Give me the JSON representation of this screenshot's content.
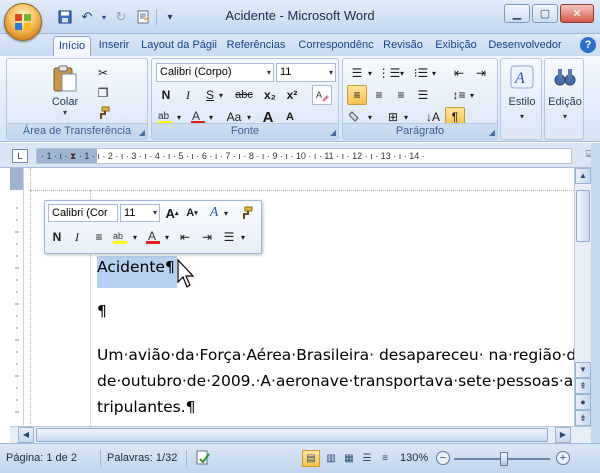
{
  "window": {
    "title": "Acidente - Microsoft Word",
    "controls": [
      "minimize",
      "maximize",
      "close"
    ]
  },
  "qat": {
    "icons": [
      "save-icon",
      "undo-icon",
      "redo-icon",
      "new-document-icon",
      "customize-icon"
    ],
    "more": "▾"
  },
  "tabs": [
    {
      "label": "Início",
      "active": true
    },
    {
      "label": "Inserir"
    },
    {
      "label": "Layout da Págii"
    },
    {
      "label": "Referências"
    },
    {
      "label": "Correspondênc"
    },
    {
      "label": "Revisão"
    },
    {
      "label": "Exibição"
    },
    {
      "label": "Desenvolvedor"
    }
  ],
  "ribbon": {
    "clipboard": {
      "group_label": "Área de Transferência",
      "paste_label": "Colar"
    },
    "font": {
      "group_label": "Fonte",
      "font_name": "Calibri (Corpo)",
      "font_size": "11",
      "bold": "N",
      "italic": "I",
      "underline": "S",
      "strike": "abc",
      "subscript": "x₂",
      "superscript": "x²",
      "change_case": "Aa",
      "grow": "A",
      "shrink": "A"
    },
    "paragraph": {
      "group_label": "Parágrafo",
      "pilcrow": "¶"
    },
    "styles": {
      "label": "Estilo"
    },
    "editing": {
      "label": "Edição"
    }
  },
  "ruler": {
    "corner": "L",
    "markings": "· 1 · ı · ⧗ · 1 · ı · 2 · ı · 3 · ı · 4 · ı · 5 · ı · 6 · ı · 7 · ı · 8 · ı · 9 · ı · 10 · ı · 11 · ı · 12 · ı · 13 · ı · 14 ·"
  },
  "mini_toolbar": {
    "font_name": "Calibri (Cor",
    "font_size": "11",
    "bold": "N",
    "italic": "I"
  },
  "document": {
    "paragraphs": [
      "Acidente¶",
      "¶",
      "Um·avião·da·Força·Aérea·Brasileira· desapareceu· na·região·da·",
      "de·outubro·de·2009.·A·aeronave·transportava·sete·pessoas·a·",
      "tripulantes.¶"
    ]
  },
  "status": {
    "page": "Página: 1 de 2",
    "words": "Palavras: 1/32",
    "zoom": "130%",
    "zoom_level_percent": 130
  }
}
